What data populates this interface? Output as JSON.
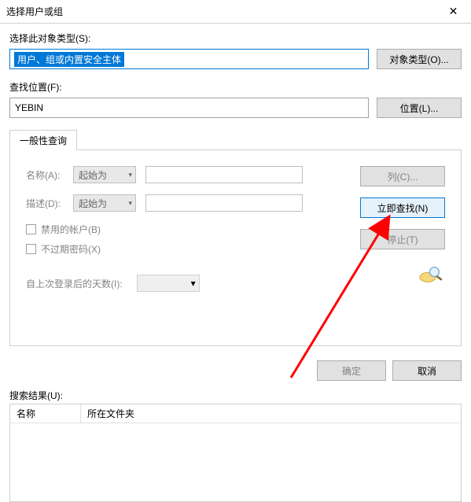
{
  "window": {
    "title": "选择用户或组",
    "close": "✕"
  },
  "sections": {
    "objectTypeLabel": "选择此对象类型(S):",
    "objectTypeValue": "用户、组或内置安全主体",
    "objectTypeBtn": "对象类型(O)...",
    "locationLabel": "查找位置(F):",
    "locationValue": "YEBIN",
    "locationBtn": "位置(L)..."
  },
  "tab": {
    "title": "一般性查询",
    "name": {
      "label": "名称(A):",
      "combo": "起始为"
    },
    "desc": {
      "label": "描述(D):",
      "combo": "起始为"
    },
    "disabledAcct": "禁用的帐户(B)",
    "noExpirePwd": "不过期密码(X)",
    "daysLabel": "自上次登录后的天数(I):"
  },
  "sideButtons": {
    "columns": "列(C)...",
    "findNow": "立即查找(N)",
    "stop": "停止(T)"
  },
  "bottom": {
    "ok": "确定",
    "cancel": "取消"
  },
  "results": {
    "label": "搜索结果(U):",
    "colName": "名称",
    "colFolder": "所在文件夹"
  }
}
